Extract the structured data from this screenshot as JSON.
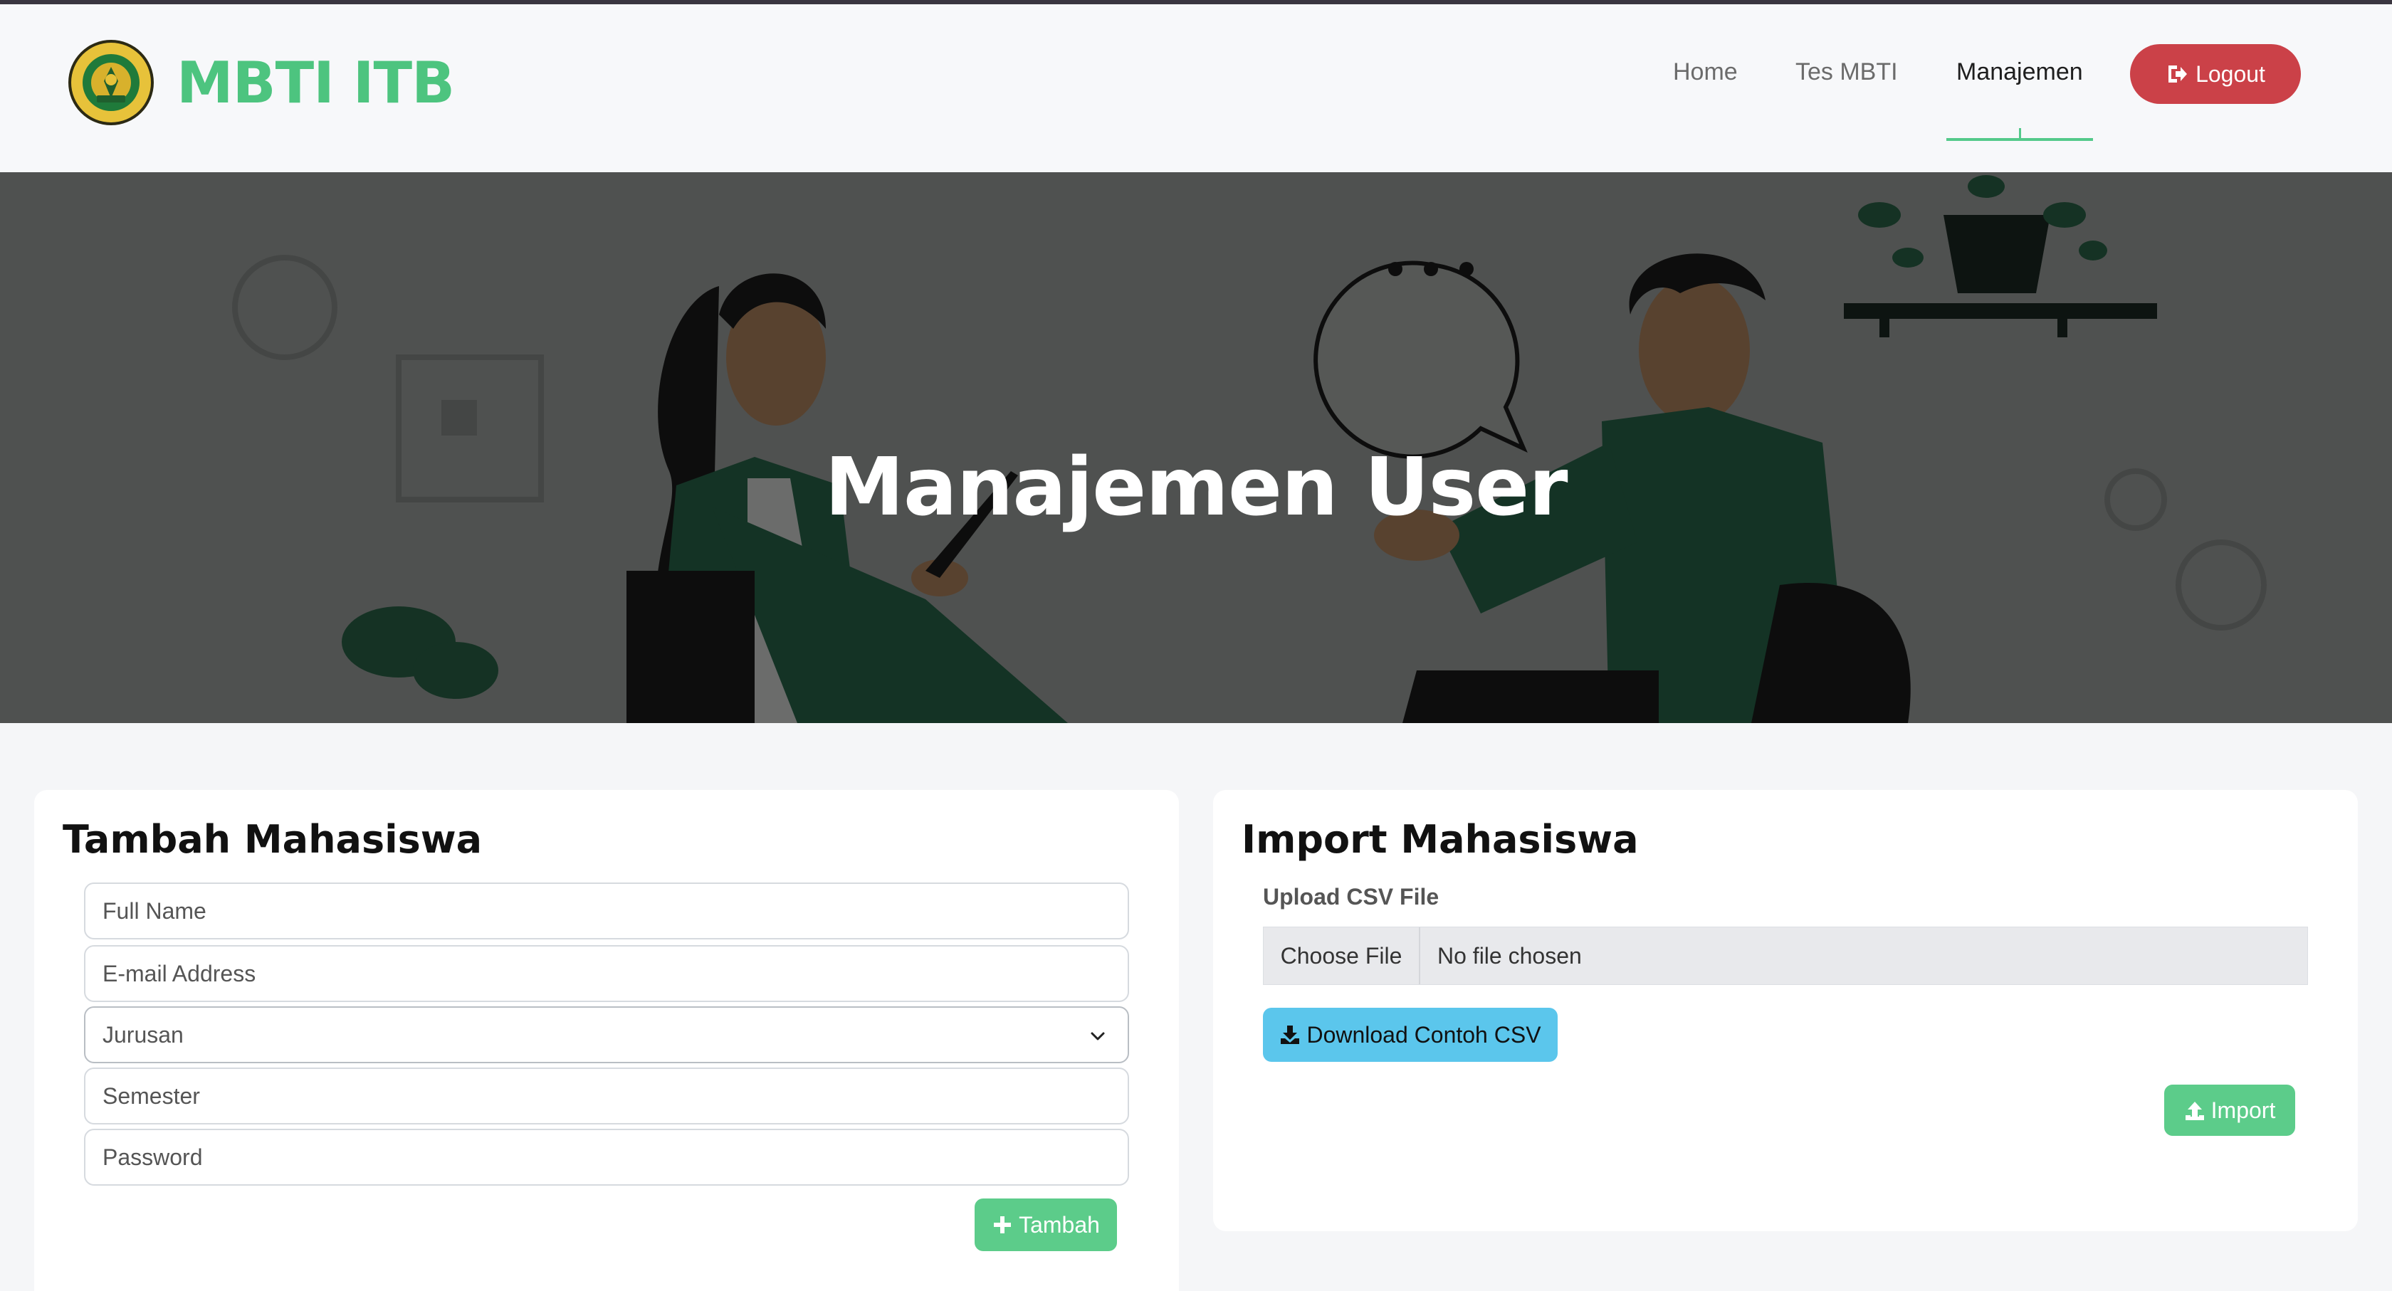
{
  "navbar": {
    "brand": "MBTI ITB",
    "links": [
      {
        "label": "Home",
        "active": false
      },
      {
        "label": "Tes MBTI",
        "active": false
      },
      {
        "label": "Manajemen",
        "active": true
      }
    ],
    "logout_label": "Logout"
  },
  "hero": {
    "title": "Manajemen User"
  },
  "add_form": {
    "title": "Tambah Mahasiswa",
    "name_placeholder": "Full Name",
    "email_placeholder": "E-mail Address",
    "jurusan_selected": "Jurusan",
    "semester_placeholder": "Semester",
    "password_placeholder": "Password",
    "submit_label": "Tambah"
  },
  "import_form": {
    "title": "Import Mahasiswa",
    "upload_label": "Upload CSV File",
    "choose_file_label": "Choose File",
    "file_status": "No file chosen",
    "download_label": "Download Contoh CSV",
    "import_label": "Import"
  },
  "colors": {
    "brand_green": "#4dc47f",
    "logout_red": "#cb4148",
    "button_green": "#5ccc8a",
    "download_blue": "#5bc6ec"
  }
}
